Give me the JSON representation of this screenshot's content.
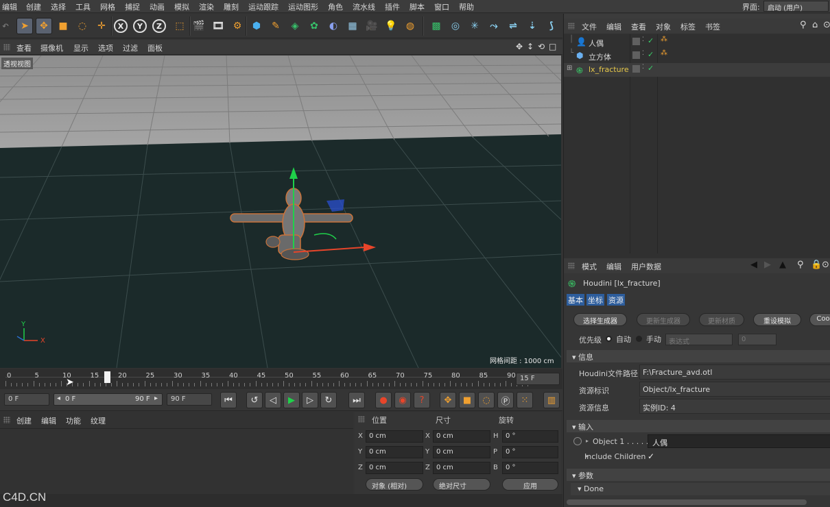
{
  "menubar": {
    "items": [
      "编辑",
      "创建",
      "选择",
      "工具",
      "网格",
      "捕捉",
      "动画",
      "模拟",
      "渲染",
      "雕刻",
      "运动跟踪",
      "运动图形",
      "角色",
      "流水线",
      "插件",
      "脚本",
      "窗口",
      "帮助"
    ],
    "layout_label": "界面:",
    "layout_value": "启动 (用户)"
  },
  "toolbar": {
    "icons": [
      "cursor-icon",
      "move-icon",
      "scale-icon",
      "rotate-icon",
      "crosshair-icon",
      "x-axis-icon",
      "y-axis-icon",
      "z-axis-icon",
      "coordinate-system-icon",
      "render-view-icon",
      "render-picture-viewer-icon",
      "render-settings-icon",
      "cube-icon",
      "pen-icon",
      "subdivision-icon",
      "cloner-icon",
      "deformer-icon",
      "floor-icon",
      "camera-icon",
      "light-icon",
      "scene-icon",
      "workplane-icon",
      "snap-icon",
      "symmetry-icon",
      "magnet-icon",
      "quantize-icon",
      "guide-icon",
      "axis-icon"
    ],
    "axis_labels": [
      "X",
      "Y",
      "Z"
    ]
  },
  "viewport_menu": [
    "查看",
    "摄像机",
    "显示",
    "选项",
    "过滤",
    "面板"
  ],
  "viewport": {
    "label": "透视视图",
    "grid_spacing": "网格间距 : 1000 cm",
    "axis_y": "Y",
    "axis_x": "X"
  },
  "timeline": {
    "ticks": [
      "0",
      "5",
      "10",
      "15",
      "20",
      "25",
      "30",
      "35",
      "40",
      "45",
      "50",
      "55",
      "60",
      "65",
      "70",
      "75",
      "80",
      "85",
      "90"
    ],
    "current_frame": 18,
    "end_field": "15 F"
  },
  "transport": {
    "start_frame": "0 F",
    "range_start": "0 F",
    "range_end": "90 F",
    "end_frame": "90 F"
  },
  "material_menu": [
    "创建",
    "编辑",
    "功能",
    "纹理"
  ],
  "coords": {
    "headers": [
      "位置",
      "尺寸",
      "旋转"
    ],
    "rows": [
      {
        "a": "X",
        "pos": "0 cm",
        "b": "X",
        "size": "0 cm",
        "c": "H",
        "rot": "0 °"
      },
      {
        "a": "Y",
        "pos": "0 cm",
        "b": "Y",
        "size": "0 cm",
        "c": "P",
        "rot": "0 °"
      },
      {
        "a": "Z",
        "pos": "0 cm",
        "b": "Z",
        "size": "0 cm",
        "c": "B",
        "rot": "0 °"
      }
    ],
    "mode_object": "对象 (相对)",
    "mode_size": "绝对尺寸",
    "apply": "应用"
  },
  "watermark": "C4D.CN",
  "object_manager": {
    "menu": [
      "文件",
      "编辑",
      "查看",
      "对象",
      "标签",
      "书签"
    ],
    "objects": [
      {
        "name": "人偶",
        "icon": "figure-icon",
        "color": "#d8d8d8"
      },
      {
        "name": "立方体",
        "icon": "cube-icon",
        "color": "#d8d8d8"
      },
      {
        "name": "lx_fracture",
        "icon": "houdini-icon",
        "color": "#e6c84a"
      }
    ]
  },
  "attribute_manager": {
    "menu": [
      "模式",
      "编辑",
      "用户数据"
    ],
    "title": "Houdini [lx_fracture]",
    "tabs": [
      "基本",
      "坐标",
      "资源"
    ],
    "buttons": [
      "选择生成器",
      "更新生成器",
      "更新材质",
      "重设模拟",
      "Coo"
    ],
    "priority_label": "优先级",
    "priority_auto": "自动",
    "priority_manual": "手动",
    "priority_expr": "表达式",
    "priority_value": "0",
    "section_info": "信息",
    "info_rows": [
      {
        "label": "Houdini文件路径",
        "value": "F:\\Fracture_avd.otl"
      },
      {
        "label": "资源标识",
        "value": "Object/lx_fracture"
      },
      {
        "label": "资源信息",
        "value": "实例ID: 4"
      }
    ],
    "section_input": "输入",
    "object1_label": "Object 1 . . . . .",
    "object1_value": "人偶",
    "include_children": "Include Children",
    "include_children_check": "✓",
    "section_params": "参数",
    "done": "Done"
  },
  "colors": {
    "accent_green": "#1fd14a",
    "accent_red": "#e8452a",
    "accent_blue": "#2a6fd0",
    "houdini_yellow": "#e6c84a"
  }
}
